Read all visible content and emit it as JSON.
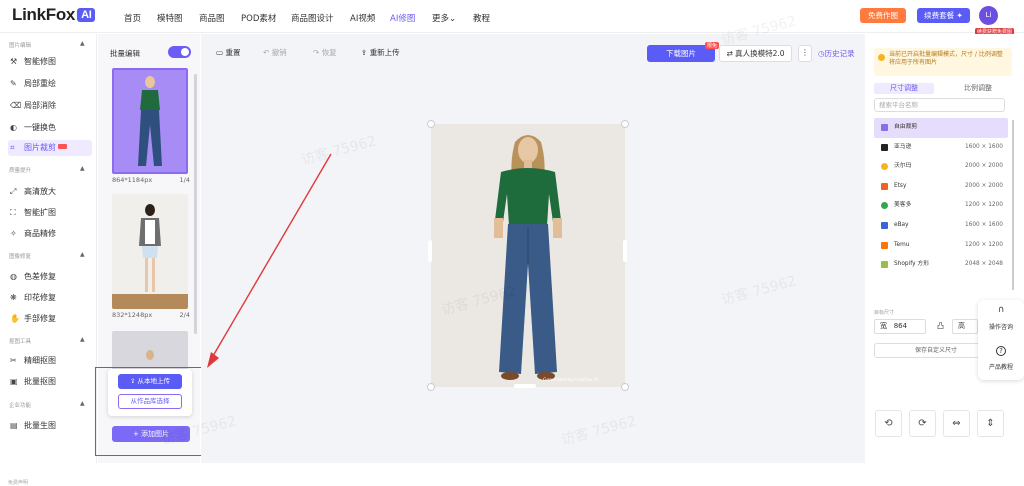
{
  "brand": {
    "name": "LinkFox",
    "badge": "AI"
  },
  "nav": [
    "首页",
    "模特图",
    "商品图",
    "POD素材",
    "商品图设计",
    "AI视频",
    "AI修图",
    "更多",
    "教程"
  ],
  "nav_more_caret": "⌄",
  "header": {
    "free_btn": "免费作图",
    "member_btn": "续费套餐",
    "member_icon": "✦",
    "avatar": "Li",
    "avatar_tag": "续费获赠免费图"
  },
  "sidebar": {
    "sections": [
      {
        "title": "图片编辑",
        "items": [
          "智能修图",
          "局部重绘",
          "局部消除",
          "一键换色",
          "图片裁剪"
        ]
      },
      {
        "title": "质量提升",
        "items": [
          "高清放大",
          "智能扩图",
          "商品精修"
        ]
      },
      {
        "title": "图像修复",
        "items": [
          "色差修复",
          "印花修复",
          "手部修复"
        ]
      },
      {
        "title": "抠图工具",
        "items": [
          "精细抠图",
          "批量抠图"
        ]
      },
      {
        "title": "企业功能",
        "items": [
          "批量生图"
        ]
      }
    ],
    "footer": "免费声明",
    "caret": "▲"
  },
  "thumbs": {
    "batch_label": "批量编辑",
    "items": [
      {
        "size": "864*1184px",
        "index": "1/4"
      },
      {
        "size": "832*1248px",
        "index": "2/4"
      }
    ],
    "upload_local": "从本地上传",
    "upload_works": "从作品库选择",
    "add_image": "添加图片",
    "add_icon": "+",
    "upload_icon": "⇪"
  },
  "toolbar": {
    "reset": "重置",
    "undo": "撤销",
    "redo": "恢复",
    "reupload": "重新上传",
    "reset_icon": "▭",
    "undo_icon": "↶",
    "redo_icon": "↷",
    "reupload_icon": "⇪",
    "download": "下载图片",
    "download_tag": "限免",
    "tryon": "真人换模特2.0",
    "tryon_icon": "⇄",
    "more": "⋮",
    "history": "历史记录",
    "history_icon": "◷"
  },
  "right_panel": {
    "notice": "当前已开启批量编辑模式，尺寸 / 比例调整将应用于所有图片",
    "tab_size": "尺寸调整",
    "tab_ratio": "比例调整",
    "search_placeholder": "搜索平台名称",
    "platforms": [
      {
        "name": "自由裁剪",
        "value": "",
        "color": "#8a6cf0"
      },
      {
        "name": "亚马逊",
        "value": "1600 × 1600",
        "color": "#222222"
      },
      {
        "name": "沃尔玛",
        "value": "2000 × 2000",
        "color": "#f5b324"
      },
      {
        "name": "Etsy",
        "value": "2000 × 2000",
        "color": "#f1641e"
      },
      {
        "name": "美客多",
        "value": "1200 × 1200",
        "color": "#2fa84f"
      },
      {
        "name": "eBay",
        "value": "1600 × 1600",
        "color": "#3b63d6"
      },
      {
        "name": "Temu",
        "value": "1200 × 1200",
        "color": "#fb7701"
      },
      {
        "name": "Shopify 方形",
        "value": "2048 × 2048",
        "color": "#95bf47"
      }
    ],
    "dim_label": "目标尺寸",
    "width_label": "宽",
    "width_value": "864",
    "link_icon": "凸",
    "height_label": "高",
    "save_custom": "保存自定义尺寸"
  },
  "float": {
    "service": "操作咨询",
    "tutorial": "产品教程",
    "service_icon": "∩",
    "tutorial_icon": "?"
  },
  "tools": [
    "⟲",
    "⟳",
    "⇔",
    "⇕"
  ],
  "watermark": "访客 75962",
  "photo_caption": "Generated by LinkFox AI"
}
